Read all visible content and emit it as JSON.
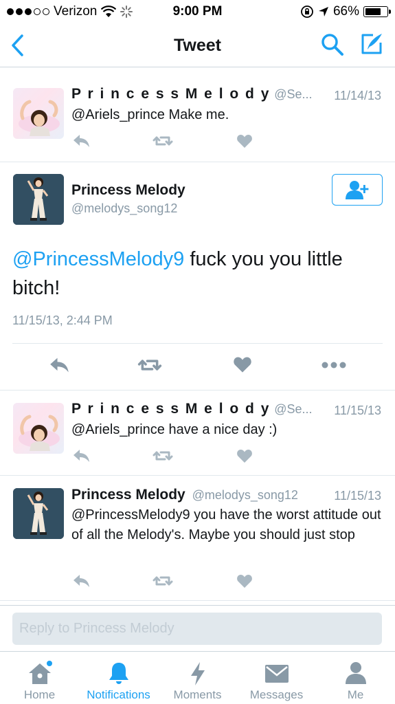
{
  "status_bar": {
    "carrier": "Verizon",
    "time": "9:00 PM",
    "battery": "66%",
    "signal_bars_filled": 3,
    "signal_bars_total": 5,
    "battery_level": 0.66
  },
  "nav": {
    "title": "Tweet",
    "back_icon": "chevron-left-icon",
    "search_icon": "search-icon",
    "compose_icon": "compose-icon"
  },
  "tweets": [
    {
      "name": "P r i n c e s s  M e l o d y",
      "handle": "@Se...",
      "date": "11/14/13",
      "text": "@Ariels_prince Make me."
    },
    {
      "name": "P r i n c e s s  M e l o d y",
      "handle": "@Se...",
      "date": "11/15/13",
      "text": "@Ariels_prince have a nice day :)"
    },
    {
      "name": "Princess Melody",
      "handle": "@melodys_song12",
      "date": "11/15/13",
      "text": "@PrincessMelody9 you have the worst attitude out of all the Melody's. Maybe you should just stop"
    }
  ],
  "main_tweet": {
    "name": "Princess Melody",
    "handle": "@melodys_song12",
    "mention": "@PrincessMelody9",
    "text": " fuck you you little bitch!",
    "timestamp": "11/15/13, 2:44 PM"
  },
  "reply": {
    "placeholder": "Reply to Princess Melody"
  },
  "tabs": [
    {
      "label": "Home",
      "icon": "home-icon",
      "active": false
    },
    {
      "label": "Notifications",
      "icon": "bell-icon",
      "active": true
    },
    {
      "label": "Moments",
      "icon": "lightning-icon",
      "active": false
    },
    {
      "label": "Messages",
      "icon": "envelope-icon",
      "active": false
    },
    {
      "label": "Me",
      "icon": "person-icon",
      "active": false
    }
  ],
  "colors": {
    "accent": "#1da1f2",
    "icon_gray": "#aab8c2",
    "text_gray": "#8899a6"
  }
}
